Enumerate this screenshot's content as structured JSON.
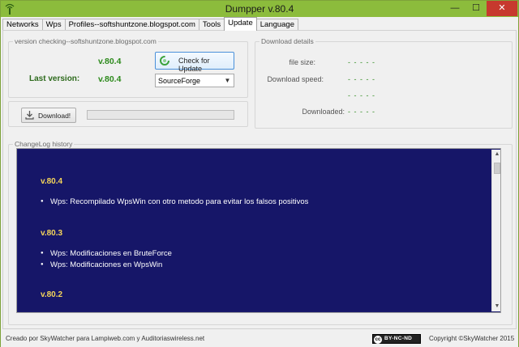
{
  "window": {
    "title": "Dumpper v.80.4",
    "controls": {
      "minimize": "—",
      "maximize": "☐",
      "close": "✕"
    }
  },
  "tabs": [
    {
      "label": "Networks"
    },
    {
      "label": "Wps"
    },
    {
      "label": "Profiles--softshuntzone.blogspot.com"
    },
    {
      "label": "Tools"
    },
    {
      "label": "Update",
      "active": true
    },
    {
      "label": "Language"
    }
  ],
  "version_group": {
    "label": "version checking--softshuntzone.blogspot.com",
    "current_version": "v.80.4",
    "last_version_label": "Last version:",
    "last_version": "v.80.4",
    "check_button": "Check for Update",
    "source_select": "SourceForge"
  },
  "download_group": {
    "button": "Download!",
    "progress": 0
  },
  "details_group": {
    "label": "Download details",
    "file_size_label": "file size:",
    "file_size_value": "- - - - -",
    "speed_label": "Download speed:",
    "speed_value": "- - - - -",
    "extra_value": "- - - - -",
    "downloaded_label": "Downloaded:",
    "downloaded_value": "- - - - -"
  },
  "changelog": {
    "label": "ChangeLog history",
    "entries": [
      {
        "version": "v.80.4",
        "items": [
          "Wps: Recompilado WpsWin con otro metodo para evitar los falsos positivos"
        ]
      },
      {
        "version": "v.80.3",
        "items": [
          "Wps: Modificaciones en BruteForce",
          "Wps: Modificaciones en WpsWin"
        ]
      },
      {
        "version": "v.80.2",
        "items": []
      }
    ]
  },
  "footer": {
    "left": "Creado por SkyWatcher para Lampiweb.com y Auditoriaswireless.net",
    "license": "BY-NC-ND",
    "license_mark": "cc",
    "right": "Copyright ©SkyWatcher 2015"
  },
  "colors": {
    "titlebar": "#8cbc3c",
    "changelog_bg": "#161668",
    "version_green": "#2d8a1c",
    "changelog_version": "#f5d55a"
  }
}
